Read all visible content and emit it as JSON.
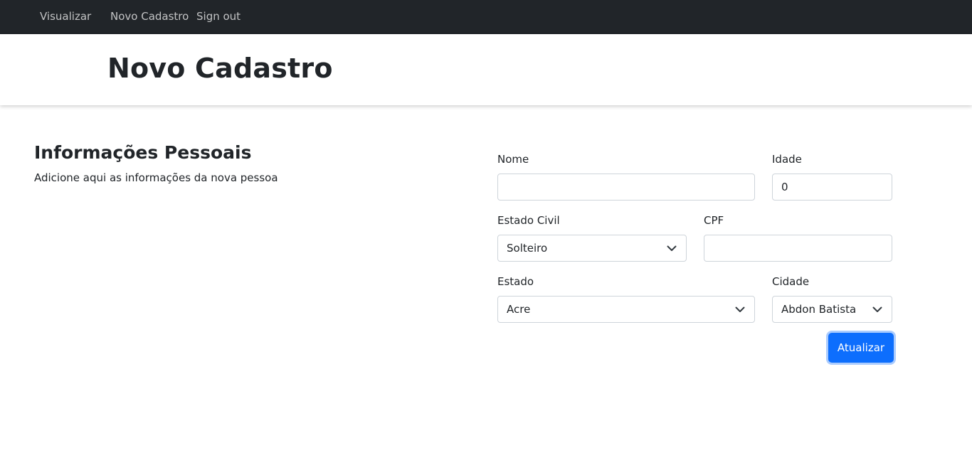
{
  "navbar": {
    "items": [
      {
        "label": "Visualizar"
      },
      {
        "label": "Novo Cadastro"
      },
      {
        "label": "Sign out"
      }
    ]
  },
  "header": {
    "title": "Novo Cadastro"
  },
  "section": {
    "title": "Informações Pessoais",
    "description": "Adicione aqui as informações da nova pessoa"
  },
  "form": {
    "nome": {
      "label": "Nome",
      "value": ""
    },
    "idade": {
      "label": "Idade",
      "value": "0"
    },
    "estado_civil": {
      "label": "Estado Civil",
      "selected": "Solteiro"
    },
    "cpf": {
      "label": "CPF",
      "value": ""
    },
    "estado": {
      "label": "Estado",
      "selected": "Acre"
    },
    "cidade": {
      "label": "Cidade",
      "selected": "Abdon Batista"
    },
    "submit_label": "Atualizar"
  },
  "colors": {
    "navbar_bg": "#212529",
    "primary": "#0d6efd",
    "border": "#ced4da"
  },
  "icons": {
    "select_arrow": "chevron-down-icon"
  }
}
